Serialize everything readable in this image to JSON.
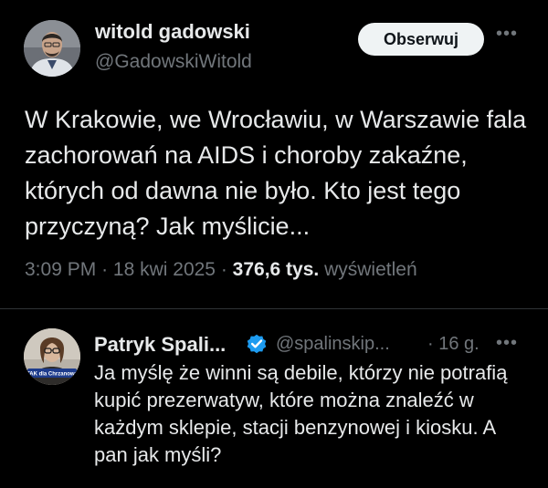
{
  "post": {
    "author_name": "witold gadowski",
    "author_handle": "@GadowskiWitold",
    "follow_label": "Obserwuj",
    "more_label": "•••",
    "text": "W Krakowie, we Wrocławiu, w Warszawie fala zachorowań na AIDS i choroby zakaźne, których od dawna nie było. Kto jest tego przyczyną? Jak myślicie...",
    "time": "3:09 PM",
    "separator": "·",
    "date": "18 kwi 2025",
    "views_count": "376,6 tys.",
    "views_label": "wyświetleń"
  },
  "reply": {
    "author_name": "Patryk Spali...",
    "author_handle": "@spalinskip...",
    "time": "· 16 g.",
    "more_label": "•••",
    "avatar_caption": "TAK dla Chrzanowa",
    "text": "Ja myślę że winni są debile, którzy nie potrafią kupić prezerwatyw, które można znaleźć w każdym sklepie, stacji benzynowej i kiosku. A pan jak myśli?"
  },
  "colors": {
    "background": "#000000",
    "text_primary": "#e7e9ea",
    "text_secondary": "#71767b",
    "verified_blue": "#1d9bf0",
    "follow_button_bg": "#eff3f4",
    "divider": "#2f3336"
  },
  "icons": {
    "verified": "verified-badge-icon",
    "more": "more-options-icon"
  }
}
